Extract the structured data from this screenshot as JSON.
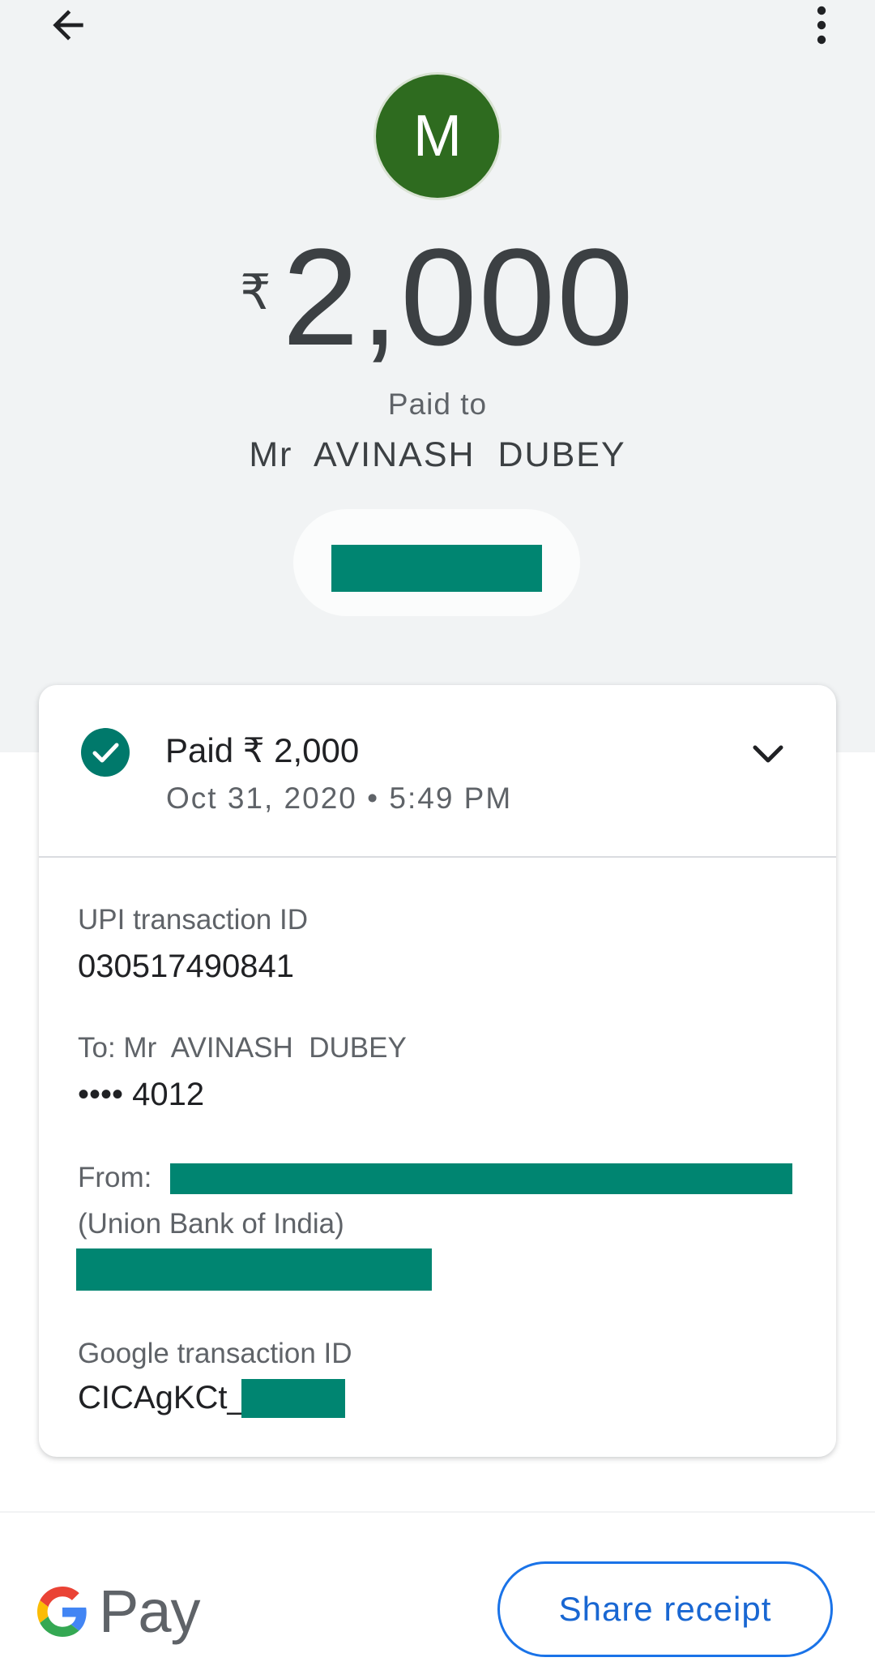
{
  "header": {
    "back_icon": "arrow-back-icon",
    "menu_icon": "more-vert-icon"
  },
  "payee": {
    "avatar_initial": "M",
    "avatar_color": "#2e6b1f",
    "currency_symbol": "₹",
    "amount": "2,000",
    "paid_to_label": "Paid to",
    "name": "Mr  AVINASH  DUBEY"
  },
  "summary": {
    "status_icon": "check-circle-icon",
    "status_color": "#00796b",
    "title": "Paid ₹ 2,000",
    "date": "Oct 31, 2020 • 5:49 PM",
    "expand_icon": "chevron-down-icon"
  },
  "details": {
    "upi_label": "UPI transaction ID",
    "upi_value": "030517490841",
    "to_label": "To: Mr  AVINASH  DUBEY",
    "to_value": "•••• 4012",
    "from_label": "From: ",
    "from_bank": "(Union Bank of India)",
    "google_label": "Google transaction ID",
    "google_value": "CICAgKCt_"
  },
  "footer": {
    "logo_text": "Pay",
    "logo_icon": "google-g-icon",
    "share_label": "Share receipt"
  },
  "colors": {
    "redaction": "#008571",
    "accent": "#1a73e8",
    "background": "#f1f3f4"
  }
}
